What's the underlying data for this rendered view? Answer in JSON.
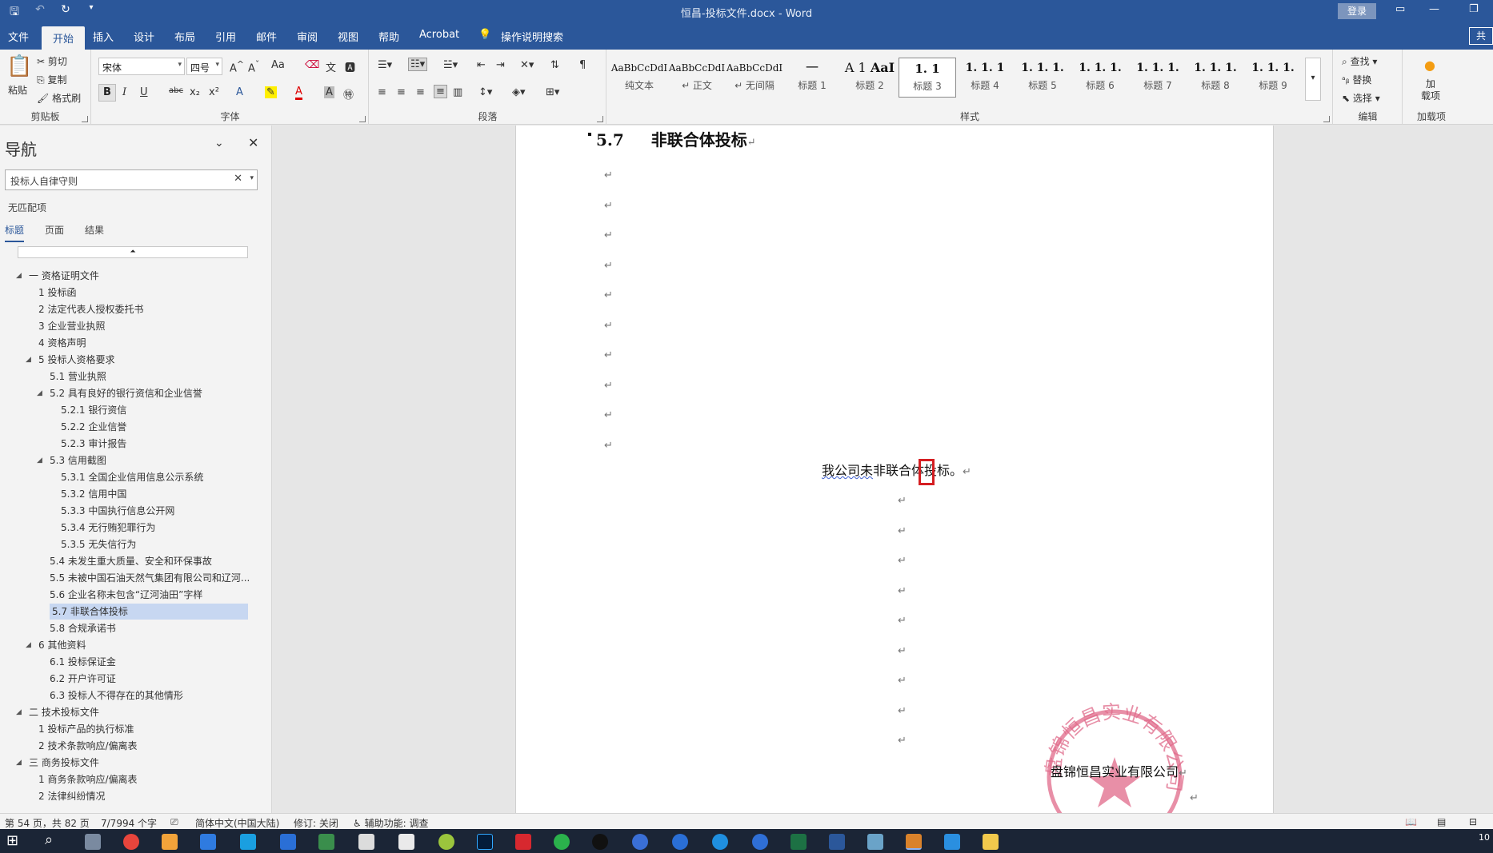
{
  "window": {
    "title": "恒昌-投标文件.docx - Word",
    "login": "登录"
  },
  "tabs": [
    "文件",
    "开始",
    "插入",
    "设计",
    "布局",
    "引用",
    "邮件",
    "审阅",
    "视图",
    "帮助",
    "Acrobat",
    "操作说明搜索"
  ],
  "share_label": "共",
  "ribbon": {
    "clipboard": {
      "label": "剪贴板",
      "paste": "粘贴",
      "cut": "剪切",
      "copy": "复制",
      "format_painter": "格式刷"
    },
    "font": {
      "label": "字体",
      "font_name": "宋体",
      "font_size": "四号",
      "case": "Aa",
      "bold": "B",
      "italic": "I",
      "underline": "U",
      "strike": "abc",
      "sub": "x₂",
      "sup": "x²",
      "font_color": "A"
    },
    "paragraph": {
      "label": "段落"
    },
    "styles": {
      "label": "样式",
      "items": [
        {
          "preview": "AaBbCcDdI",
          "name": "纯文本"
        },
        {
          "preview": "AaBbCcDdI",
          "name": "↵ 正文"
        },
        {
          "preview": "AaBbCcDdI",
          "name": "↵ 无间隔"
        },
        {
          "preview": "一",
          "name": "标题 1"
        },
        {
          "preview": "A 1",
          "name": "标题 2"
        },
        {
          "preview": "1. 1",
          "name": "标题 3"
        },
        {
          "preview": "1. 1. 1",
          "name": "标题 4"
        },
        {
          "preview": "1. 1. 1.",
          "name": "标题 5"
        },
        {
          "preview": "1. 1. 1.",
          "name": "标题 6"
        },
        {
          "preview": "1. 1. 1.",
          "name": "标题 7"
        },
        {
          "preview": "1. 1. 1.",
          "name": "标题 8"
        },
        {
          "preview": "1. 1. 1.",
          "name": "标题 9"
        }
      ],
      "aa_preview": "AaI"
    },
    "editing": {
      "label": "编辑",
      "find": "查找",
      "replace": "替换",
      "select": "选择"
    },
    "addins": {
      "label": "加载项",
      "button": "加\n载项"
    }
  },
  "nav": {
    "title": "导航",
    "search_value": "投标人自律守则",
    "no_match": "无匹配项",
    "tabs": [
      "标题",
      "页面",
      "结果"
    ],
    "tree": [
      {
        "level": 0,
        "text": "一 资格证明文件",
        "toggle": "◢"
      },
      {
        "level": 1,
        "text": "1 投标函"
      },
      {
        "level": 1,
        "text": "2 法定代表人授权委托书"
      },
      {
        "level": 1,
        "text": "3 企业营业执照"
      },
      {
        "level": 1,
        "text": "4 资格声明"
      },
      {
        "level": 1,
        "text": "5 投标人资格要求",
        "toggle": "◢"
      },
      {
        "level": 2,
        "text": "5.1 营业执照"
      },
      {
        "level": 2,
        "text": "5.2 具有良好的银行资信和企业信誉",
        "toggle": "◢"
      },
      {
        "level": 3,
        "text": "5.2.1 银行资信"
      },
      {
        "level": 3,
        "text": "5.2.2 企业信誉"
      },
      {
        "level": 3,
        "text": "5.2.3 审计报告"
      },
      {
        "level": 2,
        "text": "5.3 信用截图",
        "toggle": "◢"
      },
      {
        "level": 3,
        "text": "5.3.1 全国企业信用信息公示系统"
      },
      {
        "level": 3,
        "text": "5.3.2 信用中国"
      },
      {
        "level": 3,
        "text": "5.3.3 中国执行信息公开网"
      },
      {
        "level": 3,
        "text": "5.3.4 无行贿犯罪行为"
      },
      {
        "level": 3,
        "text": "5.3.5 无失信行为"
      },
      {
        "level": 2,
        "text": "5.4 未发生重大质量、安全和环保事故"
      },
      {
        "level": 2,
        "text": "5.5 未被中国石油天然气集团有限公司和辽河..."
      },
      {
        "level": 2,
        "text": "5.6 企业名称未包含“辽河油田”字样"
      },
      {
        "level": 2,
        "text": "5.7 非联合体投标",
        "current": true
      },
      {
        "level": 2,
        "text": "5.8 合规承诺书"
      },
      {
        "level": 1,
        "text": "6 其他资料",
        "toggle": "◢"
      },
      {
        "level": 2,
        "text": "6.1 投标保证金"
      },
      {
        "level": 2,
        "text": "6.2 开户许可证"
      },
      {
        "level": 2,
        "text": "6.3 投标人不得存在的其他情形"
      },
      {
        "level": 0,
        "text": "二 技术投标文件",
        "toggle": "◢"
      },
      {
        "level": 1,
        "text": "1 投标产品的执行标准"
      },
      {
        "level": 1,
        "text": "2 技术条款响应/偏离表"
      },
      {
        "level": 0,
        "text": "三 商务投标文件",
        "toggle": "◢"
      },
      {
        "level": 1,
        "text": "1 商务条款响应/偏离表"
      },
      {
        "level": 1,
        "text": "2 法律纠纷情况"
      }
    ]
  },
  "document": {
    "heading_num": "5.7",
    "heading_text": "非联合体投标",
    "para_mark": "↵",
    "sentence_pre": "我公司",
    "sentence_cursor_char": "未",
    "sentence_post": "非联合体投标。",
    "company": "盘锦恒昌实业有限公司",
    "seal_text": "盘锦恒昌实业有限公司"
  },
  "status": {
    "page": "第 54 页，共 82 页",
    "words": "7/7994 个字",
    "lang": "简体中文(中国大陆)",
    "track": "修订: 关闭",
    "access": "辅助功能: 调查"
  },
  "taskbar": {
    "clock": "10"
  }
}
